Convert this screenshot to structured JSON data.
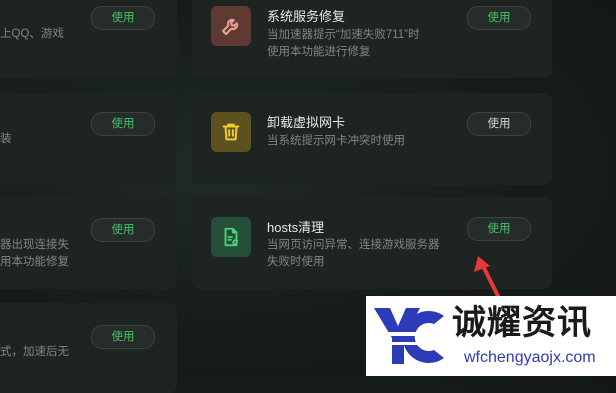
{
  "left_cards": [
    {
      "desc_lines": [
        "上QQ、游戏"
      ],
      "button": "使用"
    },
    {
      "desc_lines": [
        "装"
      ],
      "button": "使用"
    },
    {
      "desc_lines": [
        "器出现连接失",
        "用本功能修复"
      ],
      "button": "使用"
    },
    {
      "desc_lines": [
        "式，加速后无"
      ],
      "button": "使用"
    }
  ],
  "right_cards": [
    {
      "title": "系统服务修复",
      "desc_lines": [
        "当加速器提示“加速失败711”时",
        "使用本功能进行修复"
      ],
      "button": "使用",
      "icon": "wrench-icon",
      "icon_bg": "#5e3a33",
      "icon_color": "#e8a08e"
    },
    {
      "title": "卸载虚拟网卡",
      "desc_lines": [
        "当系统提示网卡冲突时使用"
      ],
      "button": "使用",
      "icon": "trash-icon",
      "icon_bg": "#5b5220",
      "icon_color": "#f2cc2e"
    },
    {
      "title": "hosts清理",
      "desc_lines": [
        "当网页访问异常、连接游戏服务器",
        "失败时使用"
      ],
      "button": "使用",
      "icon": "document-clean-icon",
      "icon_bg": "#24503a",
      "icon_color": "#4cd07a"
    }
  ],
  "colors": {
    "green_text": "#4bc26a",
    "annotation_arrow": "#e53935",
    "watermark_blue": "#2d3bb8"
  },
  "watermark": {
    "logo_text": "YC",
    "title": "诚耀资讯",
    "url": "wfchengyaojx.com"
  }
}
